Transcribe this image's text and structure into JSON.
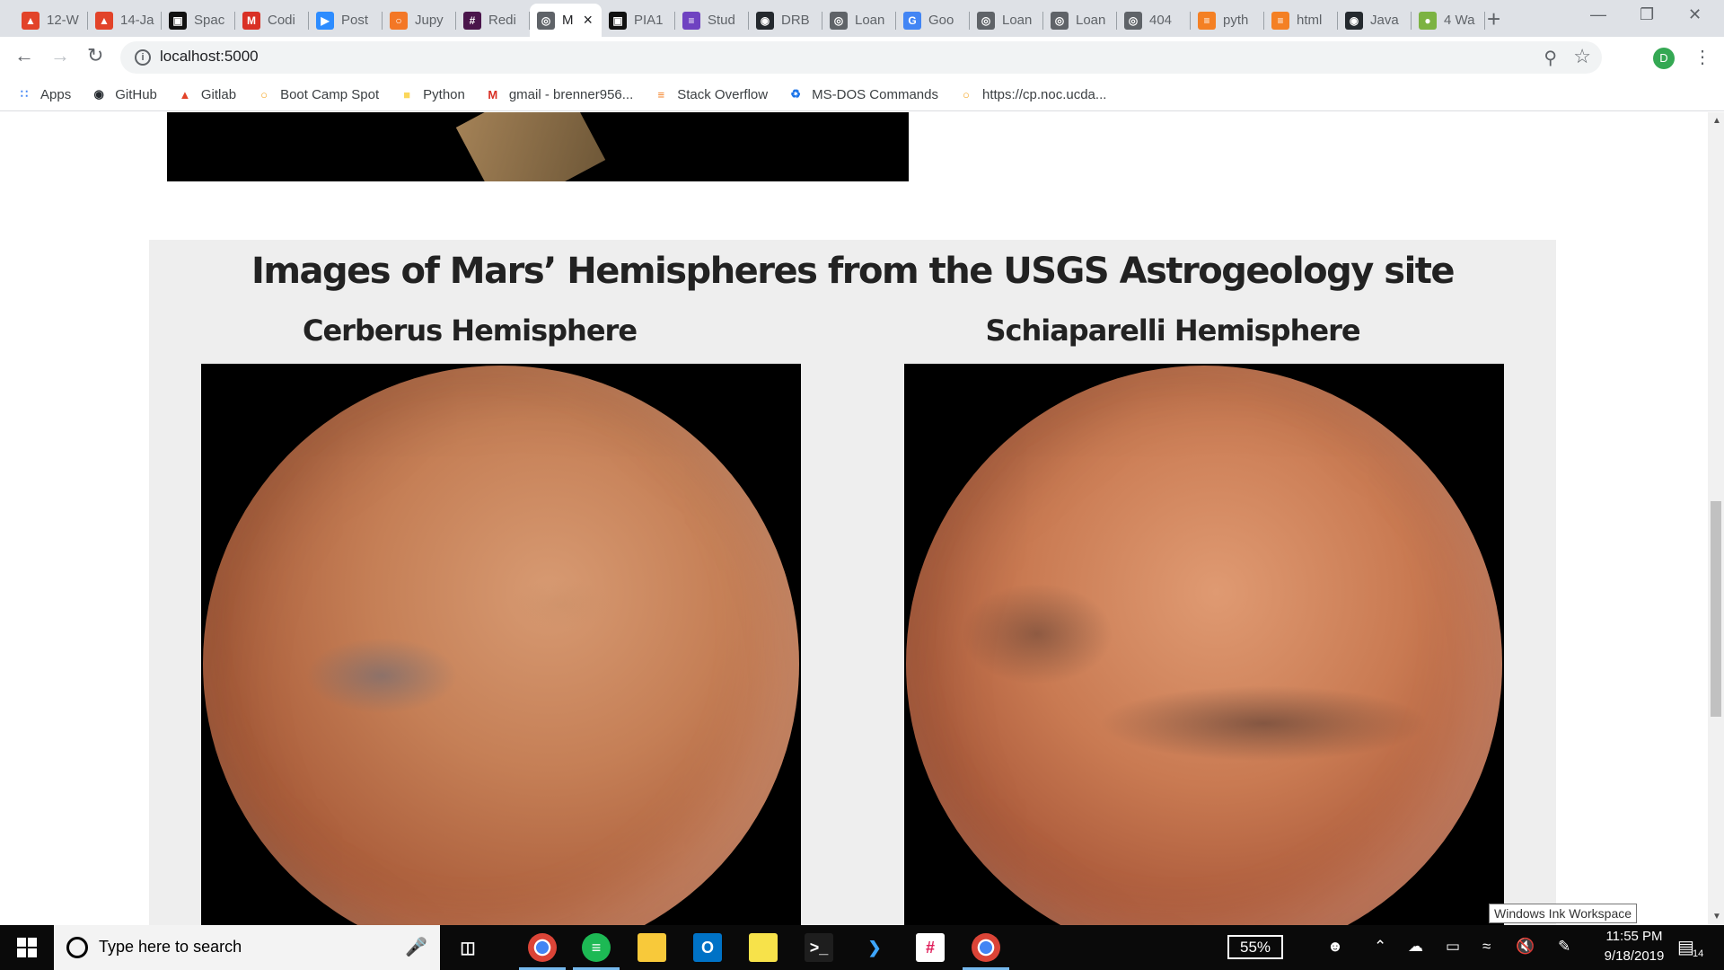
{
  "browser": {
    "tabs": [
      {
        "title": "12-W",
        "icon": "gitlab-icon",
        "color": "#e24329"
      },
      {
        "title": "14-Ja",
        "icon": "gitlab-icon",
        "color": "#e24329"
      },
      {
        "title": "Spac",
        "icon": "nasa-icon",
        "color": "#111111"
      },
      {
        "title": "Codi",
        "icon": "gmail-icon",
        "color": "#d93025"
      },
      {
        "title": "Post",
        "icon": "zoom-icon",
        "color": "#2d8cff"
      },
      {
        "title": "Jupy",
        "icon": "jupyter-icon",
        "color": "#f37726"
      },
      {
        "title": "Redi",
        "icon": "slack-icon",
        "color": "#4a154b"
      },
      {
        "title": "M",
        "icon": "globe-icon",
        "color": "#5f6368",
        "active": true
      },
      {
        "title": "PIA1",
        "icon": "nasa-icon",
        "color": "#111111"
      },
      {
        "title": "Stud",
        "icon": "list-icon",
        "color": "#6f42c1"
      },
      {
        "title": "DRB",
        "icon": "github-icon",
        "color": "#24292e"
      },
      {
        "title": "Loan",
        "icon": "globe-icon",
        "color": "#5f6368"
      },
      {
        "title": "Goo",
        "icon": "google-icon",
        "color": "#4285f4"
      },
      {
        "title": "Loan",
        "icon": "globe-icon",
        "color": "#5f6368"
      },
      {
        "title": "Loan",
        "icon": "globe-icon",
        "color": "#5f6368"
      },
      {
        "title": "404",
        "icon": "globe-icon",
        "color": "#5f6368"
      },
      {
        "title": "pyth",
        "icon": "stackoverflow-icon",
        "color": "#f48024"
      },
      {
        "title": "html",
        "icon": "stackoverflow-icon",
        "color": "#f48024"
      },
      {
        "title": "Java",
        "icon": "github-icon",
        "color": "#24292e"
      },
      {
        "title": "4 Wa",
        "icon": "whatsapp-icon",
        "color": "#7cb342"
      }
    ],
    "url": "localhost:5000",
    "profile_initial": "D",
    "bookmarks": [
      {
        "label": "Apps",
        "icon": "apps-grid-icon",
        "color": "#4285f4"
      },
      {
        "label": "GitHub",
        "icon": "github-icon",
        "color": "#24292e"
      },
      {
        "label": "Gitlab",
        "icon": "gitlab-icon",
        "color": "#e24329"
      },
      {
        "label": "Boot Camp Spot",
        "icon": "bootcamp-icon",
        "color": "#f5a623"
      },
      {
        "label": "Python",
        "icon": "folder-icon",
        "color": "#fbd75b"
      },
      {
        "label": "gmail - brenner956...",
        "icon": "gmail-icon",
        "color": "#d93025"
      },
      {
        "label": "Stack Overflow",
        "icon": "stackoverflow-icon",
        "color": "#f48024"
      },
      {
        "label": "MS-DOS Commands",
        "icon": "recycle-icon",
        "color": "#1a73e8"
      },
      {
        "label": "https://cp.noc.ucda...",
        "icon": "bootcamp-icon",
        "color": "#f5a623"
      }
    ]
  },
  "page": {
    "section_title": "Images of Mars’ Hemispheres from the USGS Astrogeology site",
    "hemispheres": [
      {
        "title": "Cerberus Hemisphere"
      },
      {
        "title": "Schiaparelli Hemisphere"
      }
    ],
    "tooltip": "Windows Ink Workspace"
  },
  "taskbar": {
    "search_placeholder": "Type here to search",
    "battery": "55%",
    "time": "11:55 PM",
    "date": "9/18/2019",
    "notification_count": "14",
    "pinned": [
      "chrome-icon",
      "spotify-icon",
      "file-explorer-icon",
      "outlook-icon",
      "sticky-notes-icon",
      "terminal-icon",
      "vscode-icon",
      "slack-icon",
      "chrome-icon"
    ]
  }
}
